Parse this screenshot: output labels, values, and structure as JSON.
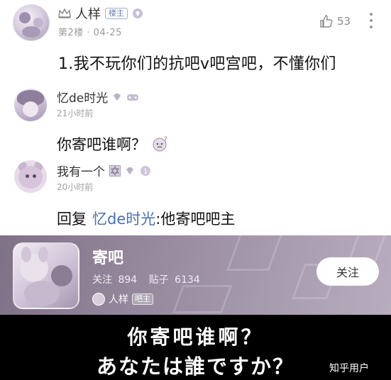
{
  "post": {
    "username": "人样",
    "badge": "楼主",
    "floor_meta": "第2楼 · 04-25",
    "like_count": "53",
    "content": "1.我不玩你们的抗吧v吧宫吧，不懂你们"
  },
  "replies": [
    {
      "username": "忆de时光",
      "time": "21小时前",
      "text": "你寄吧谁啊？"
    },
    {
      "username": "我有一个",
      "time": "20小时前",
      "reply_prefix": "回复",
      "mention": "忆de时光",
      "text": " :他寄吧吧主"
    }
  ],
  "tieba_card": {
    "name": "寄吧",
    "followers_label": "关注",
    "followers": "894",
    "posts_label": "贴子",
    "posts": "6134",
    "owner_name": "人样",
    "owner_badge": "吧主",
    "follow_button": "关注"
  },
  "meme": {
    "line1": "你寄吧谁啊？",
    "line2": "あなたは誰ですか？"
  },
  "watermark": "知乎用户",
  "colors": {
    "mention": "#4a6fb3",
    "card_bg": "#9a8da2",
    "meme_bg": "#000000"
  }
}
